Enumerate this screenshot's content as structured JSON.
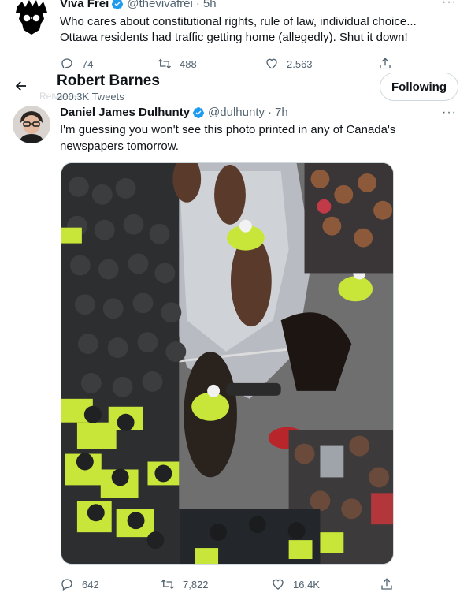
{
  "top_tweet": {
    "author_name": "Viva Frei",
    "handle": "@thevivafrei",
    "separator": "·",
    "time": "5h",
    "text": "Who cares about constitutional rights, rule of law, individual choice... Ottawa residents had traffic getting home (allegedly). Shut it down!",
    "more": "···",
    "replies": "74",
    "retweets": "488",
    "likes": "2,563"
  },
  "header": {
    "title": "Robert Barnes",
    "tweet_count": "200.3K Tweets",
    "ghost_text": "Retweeted",
    "follow_label": "Following"
  },
  "main_tweet": {
    "author_name": "Daniel James Dulhunty",
    "handle": "@dulhunty",
    "separator": "·",
    "time": "7h",
    "text": "I'm guessing you won't see this photo printed in any of Canada's newspapers tomorrow.",
    "more": "···",
    "replies": "642",
    "retweets": "7,822",
    "likes": "16.4K"
  },
  "colors": {
    "verified_blue": "#1d9bf0",
    "secondary_text": "#536471",
    "primary_text": "#0f1419",
    "hi_vis_yellow": "#c8e63a"
  }
}
